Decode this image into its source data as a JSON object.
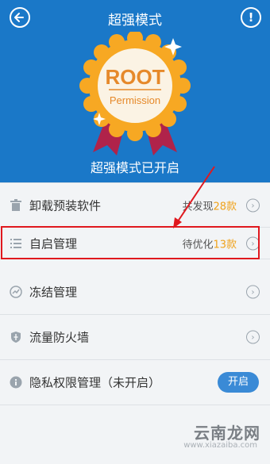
{
  "header": {
    "title": "超强模式",
    "badge_title": "ROOT",
    "badge_subtitle": "Permission",
    "status": "超强模式已开启"
  },
  "colors": {
    "header_bg": "#1a78c8",
    "accent_count": "#f0a21a",
    "highlight": "#e0181e",
    "button_bg": "#3a8ad6"
  },
  "icons": {
    "back": "back-arrow-icon",
    "info": "info-icon",
    "uninstall": "trash-icon",
    "startup": "list-icon",
    "freeze": "freeze-icon",
    "firewall": "shield-icon",
    "privacy": "info-icon"
  },
  "rows": {
    "uninstall": {
      "label": "卸载预装软件",
      "meta_prefix": "共发现",
      "meta_count": "28款"
    },
    "startup": {
      "label": "自启管理",
      "meta_prefix": "待优化",
      "meta_count": "13款"
    },
    "freeze": {
      "label": "冻结管理"
    },
    "firewall": {
      "label": "流量防火墙"
    },
    "privacy": {
      "label": "隐私权限管理（未开启）",
      "button": "开启"
    }
  },
  "watermark": {
    "logo": "云南龙网",
    "url": "www.xiazaiba.com"
  }
}
